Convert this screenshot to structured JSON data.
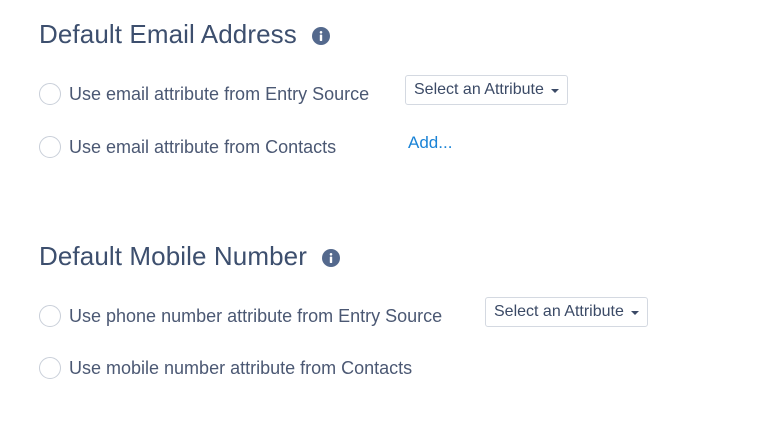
{
  "email_section": {
    "title": "Default Email Address",
    "info_icon": "info-icon",
    "options": [
      {
        "label": "Use email attribute from Entry Source",
        "selected": false
      },
      {
        "label": "Use email attribute from Contacts",
        "selected": false
      }
    ],
    "select_label": "Select an Attribute",
    "add_link": "Add..."
  },
  "mobile_section": {
    "title": "Default Mobile Number",
    "info_icon": "info-icon",
    "options": [
      {
        "label": "Use phone number attribute from Entry Source",
        "selected": false
      },
      {
        "label": "Use mobile number attribute from Contacts",
        "selected": false
      }
    ],
    "select_label": "Select an Attribute"
  },
  "colors": {
    "heading": "#3d4f6e",
    "text": "#4b5873",
    "link": "#1a83d6",
    "info_icon_bg": "#54698d",
    "radio_border": "#c9cfd9",
    "select_border": "#d4d9e1"
  }
}
